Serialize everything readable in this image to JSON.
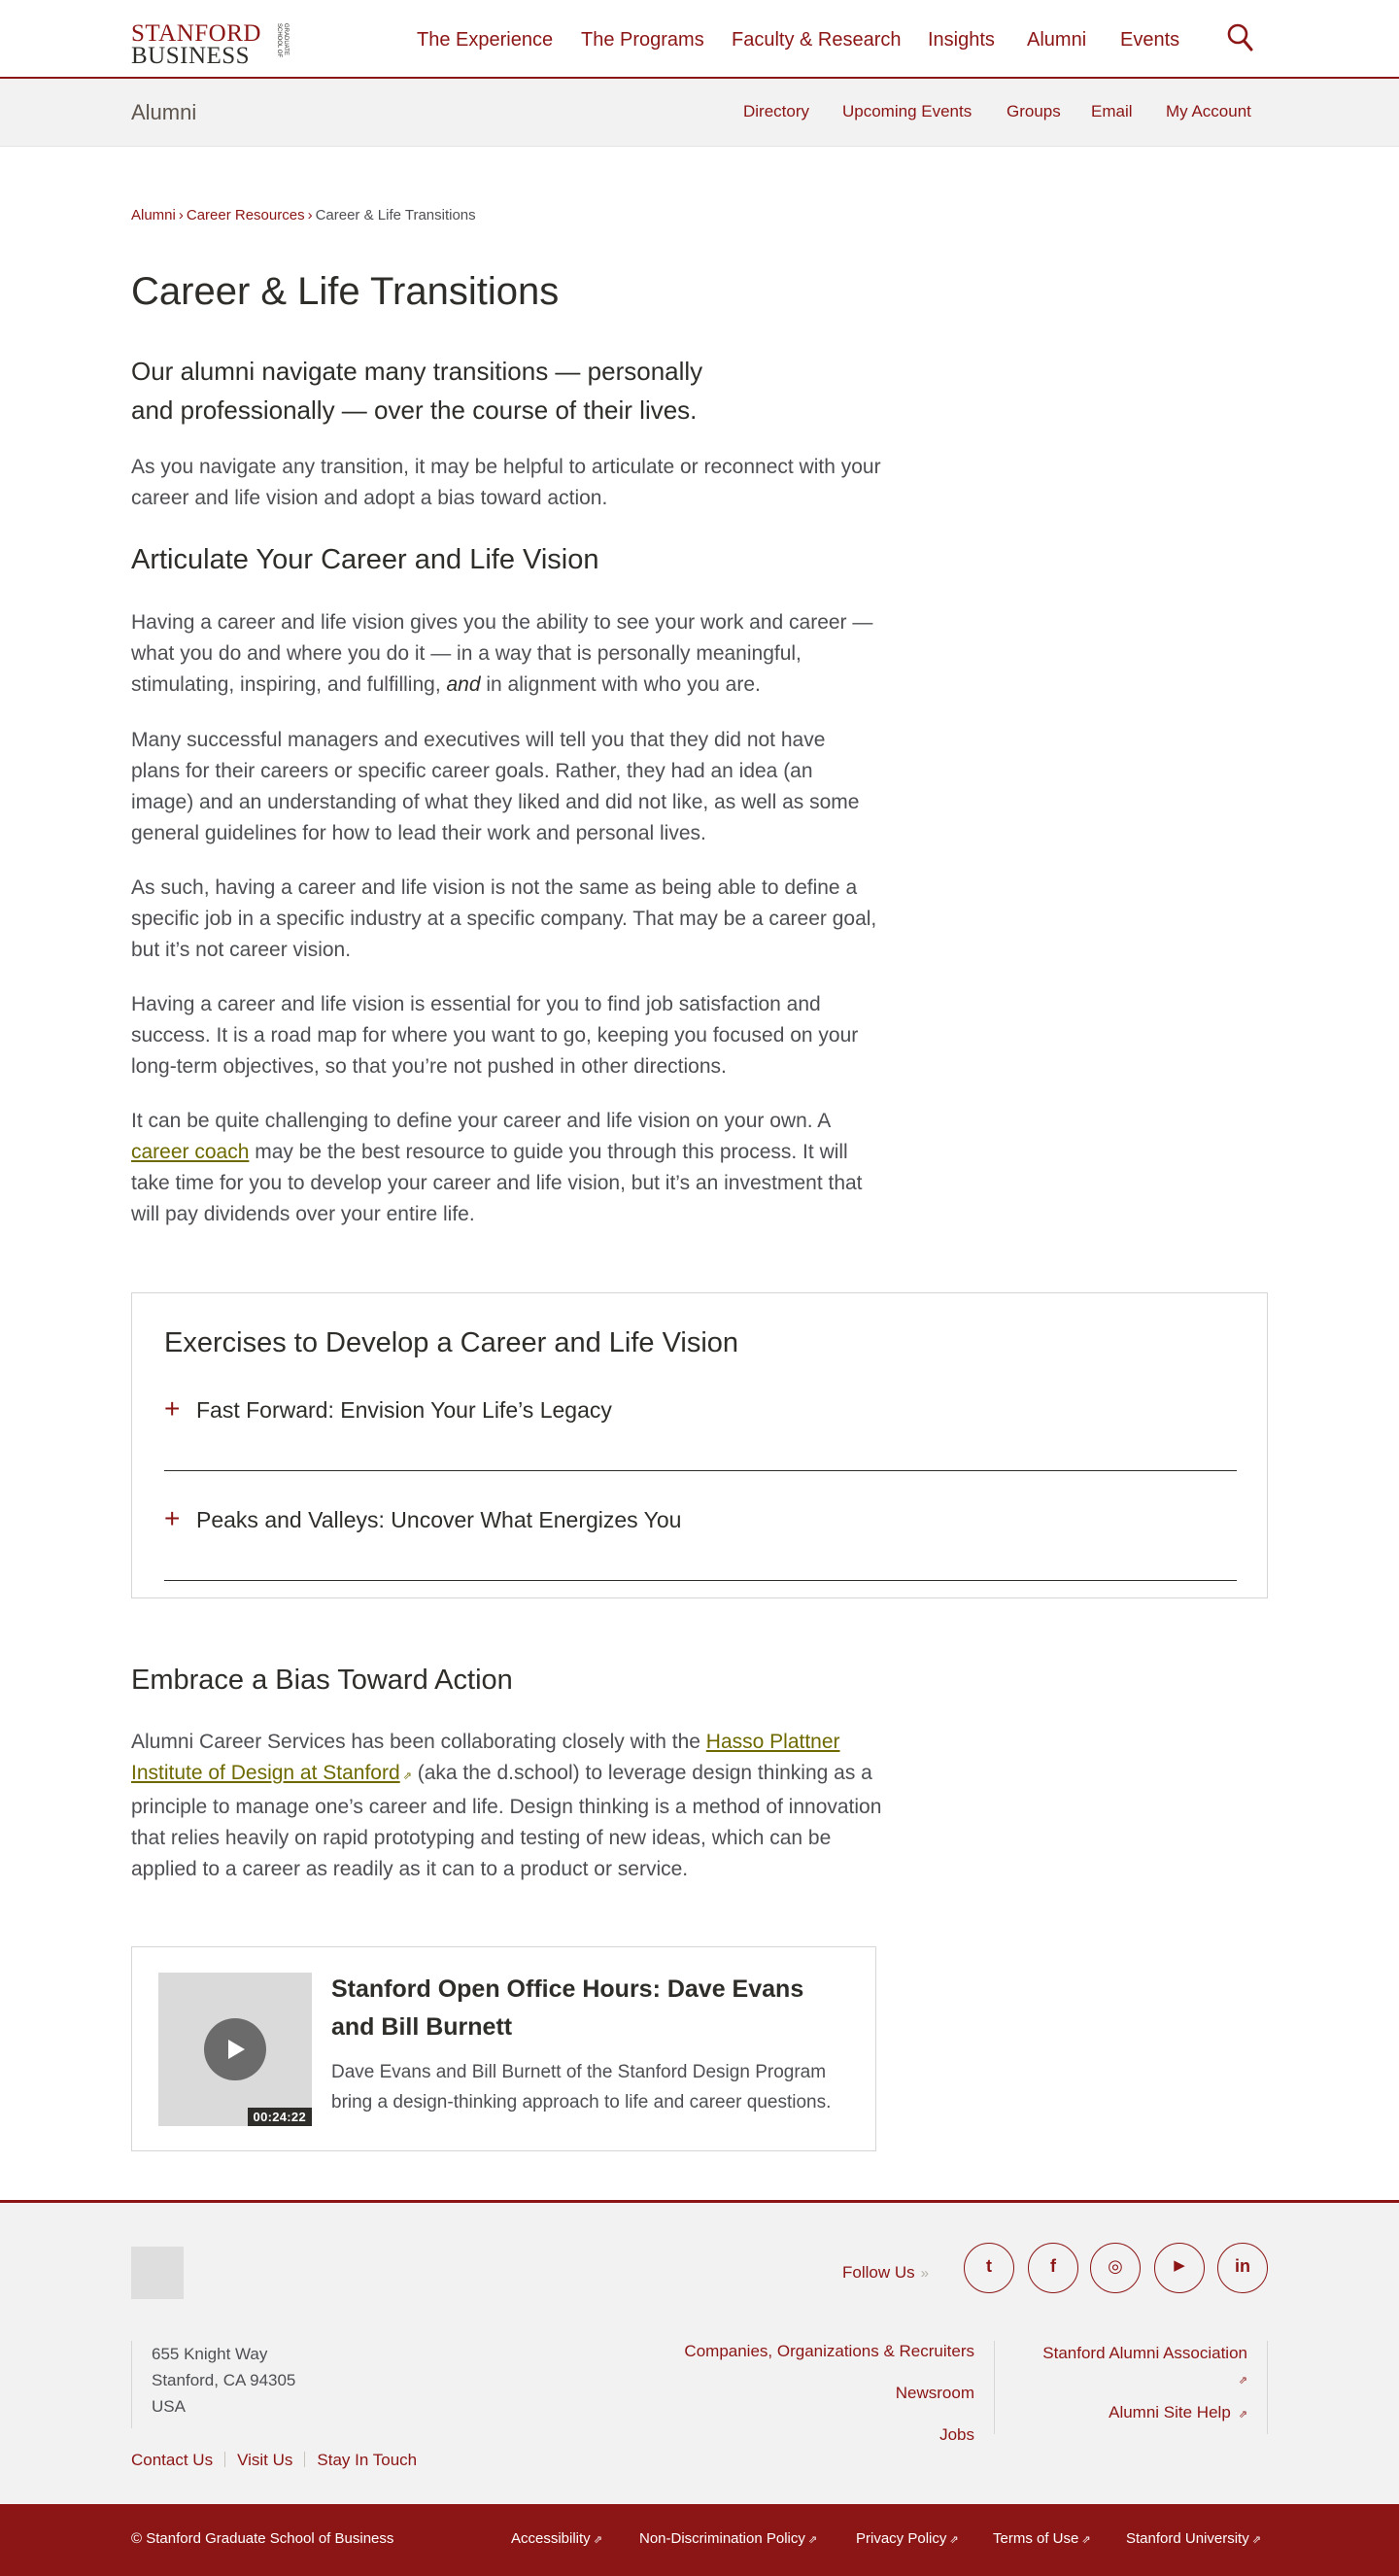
{
  "header": {
    "logo_line1": "STANFORD",
    "logo_line2": "BUSINESS",
    "logo_small": "GRADUATE SCHOOL OF",
    "nav": [
      "The Experience",
      "The Programs",
      "Faculty & Research",
      "Insights",
      "Alumni",
      "Events"
    ],
    "search_icon": "search-icon"
  },
  "subnav": {
    "section": "Alumni",
    "items": [
      "Directory",
      "Upcoming Events",
      "Groups",
      "Email",
      "My Account"
    ]
  },
  "breadcrumb": {
    "items": [
      "Alumni",
      "Career Resources"
    ],
    "current": "Career & Life Transitions",
    "separator": "›"
  },
  "page": {
    "title": "Career & Life Transitions",
    "intro": "Our alumni navigate many transitions — personally and professionally — over the course of their lives.",
    "intro_p2": "As you navigate any transition, it may be helpful to articulate or reconnect with your career and life vision and adopt a bias toward action.",
    "section1_heading": "Articulate Your Career and Life Vision",
    "s1_p1_a": "Having a career and life vision gives you the ability to see your work and career — what you do and where you do it — in a way that is personally meaningful, stimulating, inspiring, and fulfilling, ",
    "s1_p1_em": "and",
    "s1_p1_b": " in alignment with who you are.",
    "s1_p2": "Many successful managers and executives will tell you that they did not have plans for their careers or specific career goals. Rather, they had  an idea (an image) and an understanding of what they liked and did not like, as well as some general guidelines for how to lead their work and personal lives.",
    "s1_p3": "As such, having a career and life vision is not the same as being able  to define a specific job in a specific industry at a specific company. That may be a career goal, but it’s not career vision.",
    "s1_p4": "Having a career and life vision is essential for you to find job satisfaction and success. It is a road map for where you want to go, keeping you focused on your long-term objectives, so that you’re not pushed in other directions.",
    "s1_p5_a": "It can be quite challenging to define your career and life vision on your own. A ",
    "s1_p5_link": "career coach",
    "s1_p5_b": " may be the best resource to guide you through this process. It will take time for you to develop your career and life vision, but it’s an investment that will pay dividends over your entire life.",
    "section2_heading": "Embrace a Bias Toward Action",
    "s2_p1_a": "Alumni Career Services has been collaborating closely with the ",
    "s2_p1_link": "Hasso Plattner Institute of Design at Stanford",
    "s2_p1_b": " (aka the d.school) to leverage design thinking as a principle to manage one’s career and life. Design thinking is a method of innovation that relies heavily on rapid prototyping and testing of new ideas, which can be applied to a career as readily as it can to a product or service."
  },
  "exercises": {
    "heading": "Exercises to Develop a Career and Life Vision",
    "items": [
      "Fast Forward: Envision Your Life’s Legacy",
      "Peaks and Valleys: Uncover What Energizes You"
    ],
    "toggle_glyph": "+"
  },
  "video": {
    "title": "Stanford Open Office Hours: Dave Evans and Bill Burnett",
    "description": "Dave Evans and Bill Burnett of the Stanford Design Program bring a design-thinking approach to life and career questions.",
    "duration": "00:24:22"
  },
  "footer": {
    "follow": "Follow Us",
    "follow_chevron": "»",
    "social": [
      {
        "name": "twitter",
        "glyph": "t"
      },
      {
        "name": "facebook",
        "glyph": "f"
      },
      {
        "name": "instagram",
        "glyph": "◎"
      },
      {
        "name": "youtube",
        "glyph": "▶"
      },
      {
        "name": "linkedin",
        "glyph": "in"
      }
    ],
    "address": [
      "655 Knight Way",
      "Stanford, CA 94305",
      "USA"
    ],
    "links": [
      "Contact Us",
      "Visit Us",
      "Stay In Touch"
    ],
    "mid_links": [
      "Companies, Organizations & Recruiters",
      "Newsroom",
      "Jobs"
    ],
    "right_links": [
      "Stanford Alumni Association",
      "Alumni Site Help"
    ],
    "ext_glyph": "⇗"
  },
  "bottom": {
    "copyright": "© Stanford Graduate School of Business",
    "links": [
      "Accessibility",
      "Non-Discrimination Policy",
      "Privacy Policy",
      "Terms of Use",
      "Stanford University"
    ]
  },
  "colors": {
    "brand": "#8c1515",
    "link_olive": "#6e6a00",
    "text": "#2e2d29"
  }
}
